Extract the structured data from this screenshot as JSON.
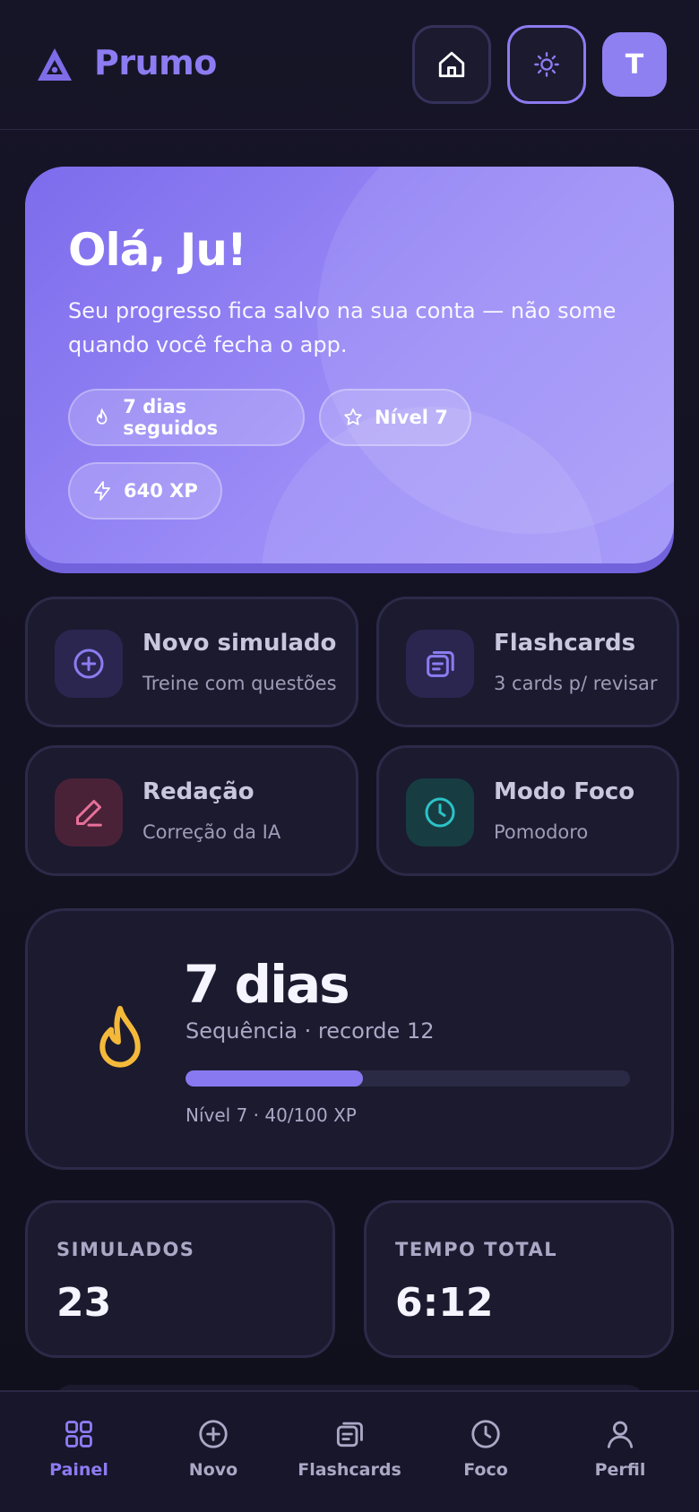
{
  "header": {
    "brand": "Prumo",
    "avatar_initial": "T"
  },
  "hero": {
    "title": "Olá, Ju!",
    "subtitle": "Seu progresso fica salvo na sua conta — não some quando você fecha o app.",
    "pills": [
      {
        "icon": "flame-icon",
        "label": "7 dias seguidos"
      },
      {
        "icon": "star-icon",
        "label": "Nível 7"
      },
      {
        "icon": "bolt-icon",
        "label": "640 XP"
      }
    ]
  },
  "actions": [
    {
      "icon": "plus-circle-icon",
      "title": "Novo simulado",
      "subtitle": "Treine com questões",
      "color": "#8b7cf0"
    },
    {
      "icon": "cards-icon",
      "title": "Flashcards",
      "subtitle": "3 cards p/ revisar",
      "color": "#8b7cf0"
    },
    {
      "icon": "pencil-icon",
      "title": "Redação",
      "subtitle": "Correção da IA",
      "color": "#e6709a"
    },
    {
      "icon": "clock-icon",
      "title": "Modo Foco",
      "subtitle": "Pomodoro",
      "color": "#2cc3c8"
    }
  ],
  "streak": {
    "title": "7 dias",
    "subtitle": "Sequência · recorde 12",
    "progress": 0.4,
    "level_text": "Nível 7 · 40/100 XP"
  },
  "stats": [
    {
      "label": "SIMULADOS",
      "value": "23"
    },
    {
      "label": "TEMPO TOTAL",
      "value": "6:12"
    }
  ],
  "nav": [
    {
      "icon": "grid-icon",
      "label": "Painel",
      "active": true
    },
    {
      "icon": "plus-circle-icon",
      "label": "Novo",
      "active": false
    },
    {
      "icon": "cards-icon",
      "label": "Flashcards",
      "active": false
    },
    {
      "icon": "clock-icon",
      "label": "Foco",
      "active": false
    },
    {
      "icon": "user-icon",
      "label": "Perfil",
      "active": false
    }
  ],
  "colors": {
    "accent": "#8c7cf2",
    "background": "#12111f",
    "card": "#1b1a2f",
    "flame": "#f5b93a"
  }
}
